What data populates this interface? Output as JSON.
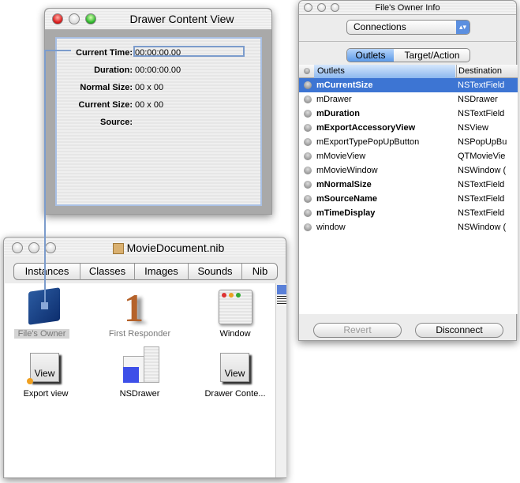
{
  "drawer_window": {
    "title": "Drawer Content View",
    "fields": [
      {
        "label": "Current Time:",
        "value": "00:00:00.00"
      },
      {
        "label": "Duration:",
        "value": "00:00:00.00"
      },
      {
        "label": "Normal Size:",
        "value": "00 x 00"
      },
      {
        "label": "Current Size:",
        "value": "00 x 00"
      },
      {
        "label": "Source:",
        "value": ""
      }
    ]
  },
  "nib_window": {
    "title": "MovieDocument.nib",
    "tabs": [
      "Instances",
      "Classes",
      "Images",
      "Sounds",
      "Nib"
    ],
    "active_tab": "Instances",
    "items": [
      {
        "label": "File's Owner",
        "icon": "cube-icon"
      },
      {
        "label": "First Responder",
        "icon": "first-responder-icon"
      },
      {
        "label": "Window",
        "icon": "window-icon"
      },
      {
        "label": "Export view",
        "icon": "view-icon"
      },
      {
        "label": "NSDrawer",
        "icon": "drawer-icon"
      },
      {
        "label": "Drawer Conte...",
        "icon": "view-icon"
      }
    ],
    "view_label": "View"
  },
  "info_window": {
    "title": "File's Owner Info",
    "popup": "Connections",
    "tabs": [
      "Outlets",
      "Target/Action"
    ],
    "active_tab": "Outlets",
    "columns": [
      "Outlets",
      "Destination"
    ],
    "rows": [
      {
        "name": "mCurrentSize",
        "dest": "NSTextField",
        "bold": true,
        "selected": true
      },
      {
        "name": "mDrawer",
        "dest": "NSDrawer",
        "bold": false
      },
      {
        "name": "mDuration",
        "dest": "NSTextField",
        "bold": true
      },
      {
        "name": "mExportAccessoryView",
        "dest": "NSView",
        "bold": true
      },
      {
        "name": "mExportTypePopUpButton",
        "dest": "NSPopUpBu",
        "bold": false
      },
      {
        "name": "mMovieView",
        "dest": "QTMovieVie",
        "bold": false
      },
      {
        "name": "mMovieWindow",
        "dest": "NSWindow (",
        "bold": false
      },
      {
        "name": "mNormalSize",
        "dest": "NSTextField",
        "bold": true
      },
      {
        "name": "mSourceName",
        "dest": "NSTextField",
        "bold": true
      },
      {
        "name": "mTimeDisplay",
        "dest": "NSTextField",
        "bold": true
      },
      {
        "name": "window",
        "dest": "NSWindow (",
        "bold": false
      }
    ],
    "revert": "Revert",
    "disconnect": "Disconnect"
  },
  "colors": {
    "selection": "#3d75d3",
    "connection": "#7c9ccc"
  }
}
